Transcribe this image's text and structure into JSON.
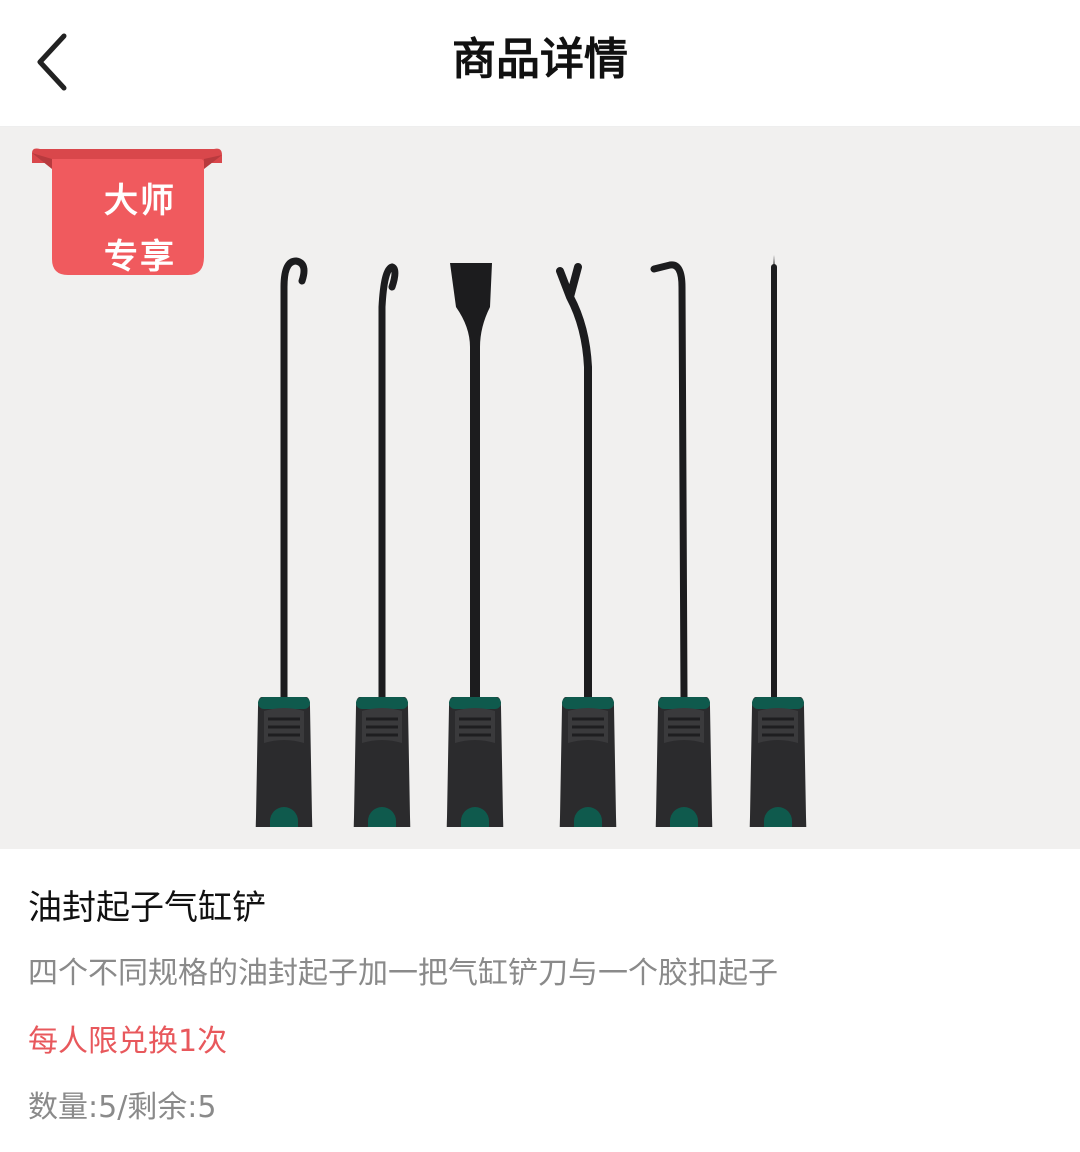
{
  "header": {
    "title": "商品详情",
    "back_icon": "chevron-left-icon"
  },
  "hero": {
    "badge": {
      "line1": "大师",
      "line2": "专享",
      "color": "#f05a5e"
    },
    "image_subject": "product-photo-tools"
  },
  "product": {
    "name": "油封起子气缸铲",
    "description": "四个不同规格的油封起子加一把气缸铲刀与一个胶扣起子",
    "limit": "每人限兑换1次",
    "quantity": "数量:5/剩余:5"
  },
  "colors": {
    "accent_red": "#e8585c",
    "hero_bg": "#f1f0ef",
    "handle_dark": "#2b2b2d",
    "handle_green": "#0f5a4d"
  }
}
